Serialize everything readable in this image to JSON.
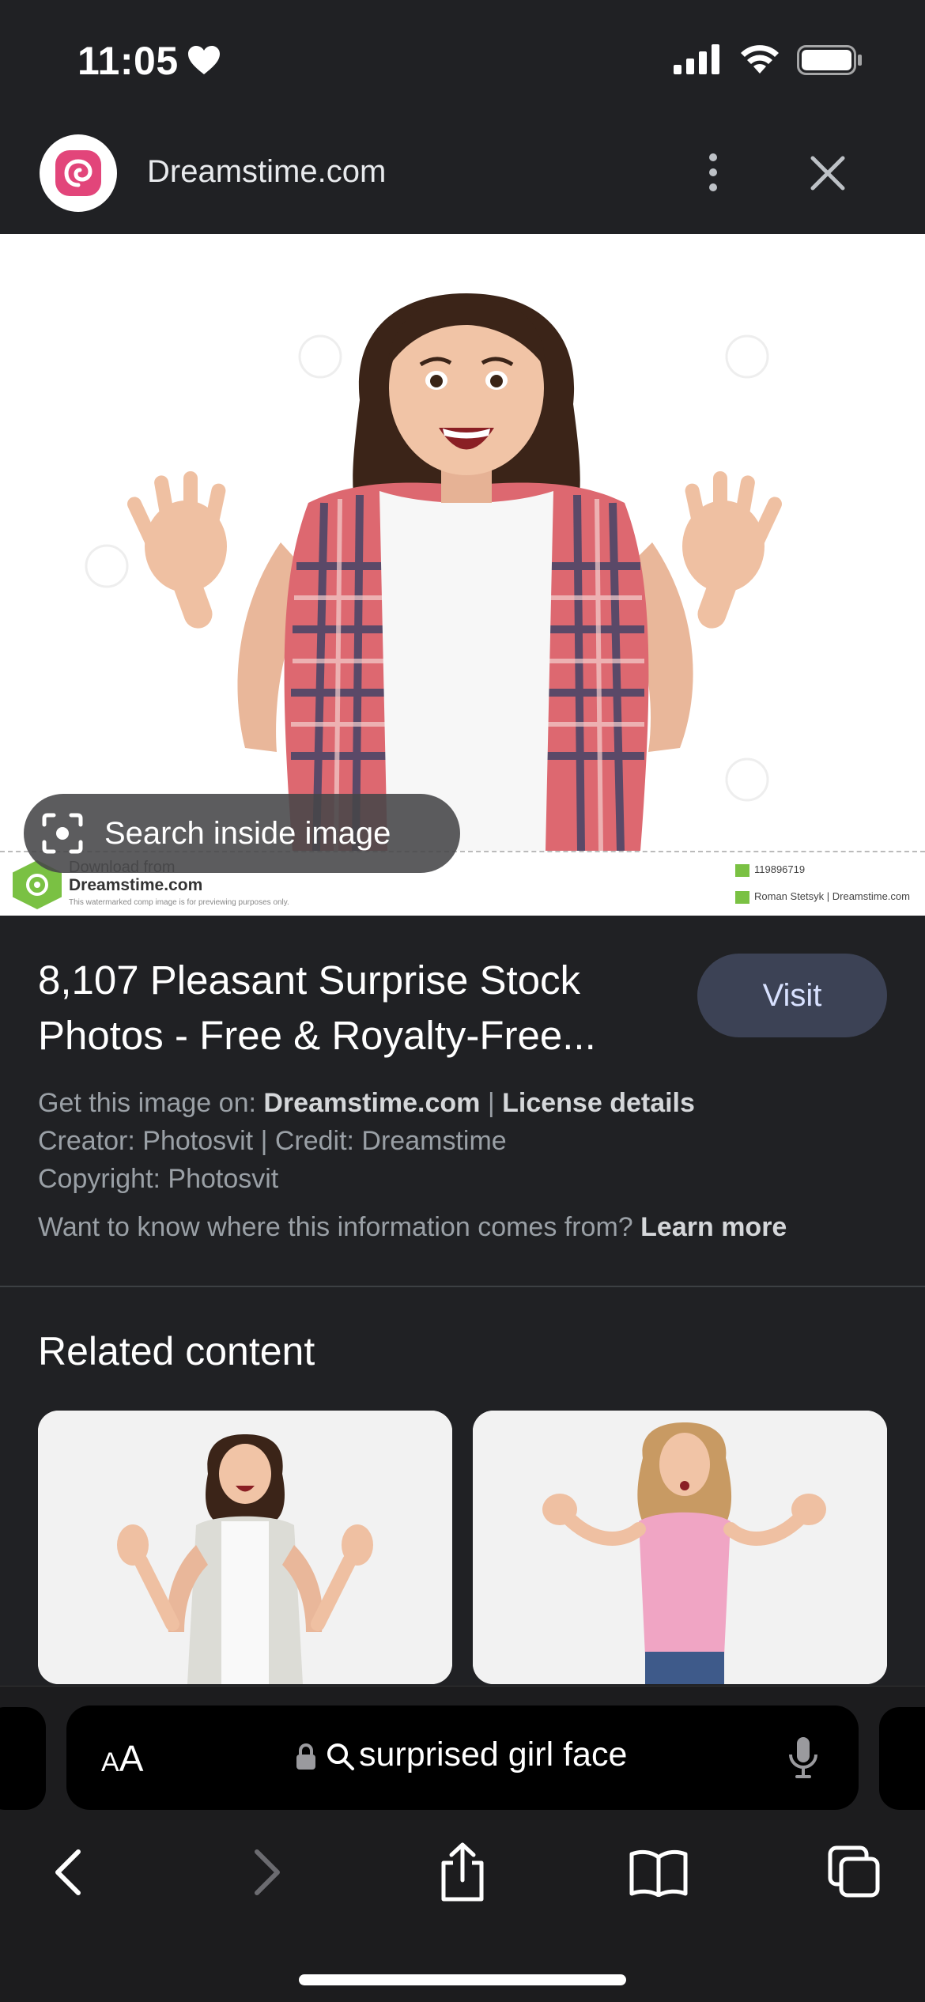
{
  "status_bar": {
    "time": "11:05",
    "icons": [
      "heart-icon",
      "cellular-signal-icon",
      "wifi-icon",
      "battery-icon"
    ]
  },
  "site_header": {
    "site_name": "Dreamstime.com",
    "icons": [
      "dreamstime-logo-icon",
      "more-vert-icon",
      "close-icon"
    ]
  },
  "hero_image": {
    "description_icon": "photo",
    "watermark": {
      "download_from": "Download from",
      "brand": "Dreamstime.com",
      "note": "This watermarked comp image is for previewing purposes only.",
      "id": "119896719",
      "author": "Roman Stetsyk | Dreamstime.com"
    },
    "lens_chip_label": "Search inside image"
  },
  "result": {
    "title": "8,107 Pleasant Surprise Stock Photos - Free & Royalty-Free...",
    "visit_label": "Visit",
    "source_prefix": "Get this image on: ",
    "source_site": "Dreamstime.com",
    "source_sep": " | ",
    "license_link": "License details",
    "creator_line": "Creator: Photosvit | Credit: Dreamstime",
    "copyright_line": "Copyright: Photosvit",
    "info_question": "Want to know where this information comes from? ",
    "learn_more": "Learn more"
  },
  "related": {
    "heading": "Related content"
  },
  "toolbar": {
    "text_size_label_big": "A",
    "text_size_label_small": "A",
    "search_query": "surprised girl face",
    "icons": [
      "lock-icon",
      "search-icon",
      "microphone-icon",
      "back-icon",
      "forward-icon",
      "share-icon",
      "bookmarks-icon",
      "tabs-icon"
    ]
  },
  "colors": {
    "background": "#202124",
    "visit_button": "#3c4255",
    "toolbar": "#1c1c1e",
    "brand_pink": "#e2457a",
    "brand_green": "#7ac143"
  }
}
